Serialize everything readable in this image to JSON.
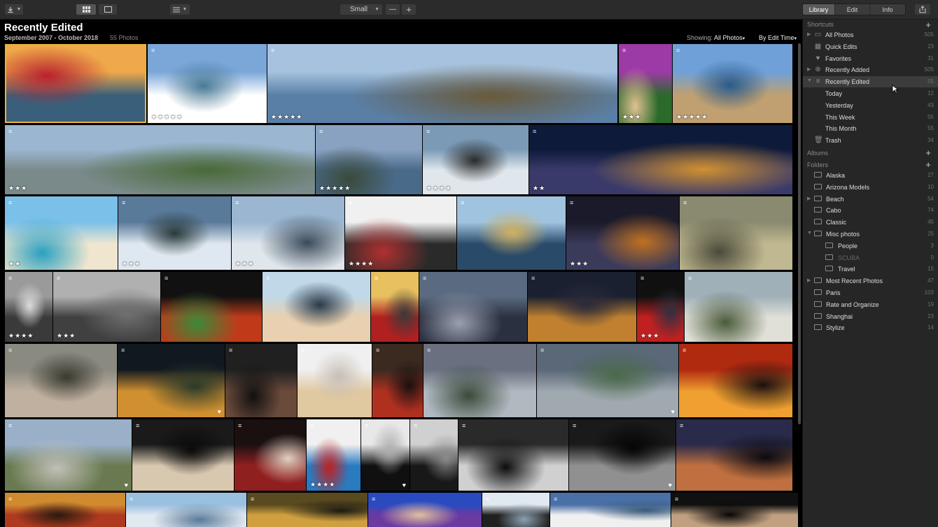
{
  "toolbar": {
    "import_icon": "download-icon",
    "view_grid_icon": "grid-icon",
    "view_single_icon": "single-view-icon",
    "sort_icon": "list-icon",
    "thumb_size": "Small",
    "zoom_out": "—",
    "zoom_in": "+",
    "modes": [
      "Library",
      "Edit",
      "Info"
    ],
    "active_mode": "Library",
    "share_icon": "share-icon"
  },
  "header": {
    "title": "Recently Edited",
    "date_range": "September 2007 - October 2018",
    "count": "55 Photos",
    "showing_label": "Showing:",
    "showing_value": "All Photos",
    "sort_value": "By Edit Time"
  },
  "sidebar": {
    "shortcuts_label": "Shortcuts",
    "shortcuts": [
      {
        "label": "All Photos",
        "count": "505",
        "icon": "photos-icon",
        "expandable": true
      },
      {
        "label": "Quick Edits",
        "count": "23",
        "icon": "quick-edits-icon"
      },
      {
        "label": "Favorites",
        "count": "31",
        "icon": "heart-icon"
      },
      {
        "label": "Recently Added",
        "count": "505",
        "icon": "plus-circle-icon",
        "expandable": true
      },
      {
        "label": "Recently Edited",
        "count": "55",
        "icon": "sliders-icon",
        "expandable": true,
        "selected": true
      },
      {
        "label": "Today",
        "count": "12",
        "indent": true
      },
      {
        "label": "Yesterday",
        "count": "43",
        "indent": true
      },
      {
        "label": "This Week",
        "count": "55",
        "indent": true
      },
      {
        "label": "This Month",
        "count": "55",
        "indent": true
      },
      {
        "label": "Trash",
        "count": "34",
        "icon": "trash-icon"
      }
    ],
    "albums_label": "Albums",
    "folders_label": "Folders",
    "folders": [
      {
        "label": "Alaska",
        "count": "27"
      },
      {
        "label": "Arizona Models",
        "count": "10"
      },
      {
        "label": "Beach",
        "count": "54",
        "expandable": true
      },
      {
        "label": "Cabo",
        "count": "74"
      },
      {
        "label": "Classic",
        "count": "45"
      },
      {
        "label": "Misc photos",
        "count": "25",
        "expandable": true,
        "open": true
      },
      {
        "label": "People",
        "count": "3",
        "sub": true
      },
      {
        "label": "SCUBA",
        "count": "0",
        "sub": true,
        "dim": true
      },
      {
        "label": "Travel",
        "count": "15",
        "sub": true
      },
      {
        "label": "Most Recent Photos",
        "count": "47",
        "expandable": true
      },
      {
        "label": "Paris",
        "count": "103"
      },
      {
        "label": "Rate and Organize",
        "count": "19"
      },
      {
        "label": "Shanghai",
        "count": "23"
      },
      {
        "label": "Stylize",
        "count": "14"
      }
    ]
  },
  "photos": [
    {
      "stars": 0,
      "c1": "#f0a94a",
      "c2": "#3a5f7a",
      "c3": "#b8222e",
      "selected": true
    },
    {
      "stars": 5,
      "c1": "#7aa6d8",
      "c2": "#ffffff",
      "c3": "#4a7a96"
    },
    {
      "stars": 5,
      "c1": "#a6c2de",
      "c2": "#5a7fa6",
      "c3": "#6a5a3a"
    },
    {
      "stars": 3,
      "c1": "#9c3aa6",
      "c2": "#2a6a2a",
      "c3": "#e0c090"
    },
    {
      "stars": 5,
      "c1": "#6fa0d8",
      "c2": "#c0a070",
      "c3": "#2a5a8a"
    },
    {
      "stars": 3,
      "c1": "#9ab6d0",
      "c2": "#7a8a8a",
      "c3": "#4a6a3a"
    },
    {
      "stars": 5,
      "c1": "#8aa2c2",
      "c2": "#4a6a8a",
      "c3": "#3a4a3a"
    },
    {
      "stars": 4,
      "c1": "#7a9ab6",
      "c2": "#dfe6ec",
      "c3": "#2a2a2a"
    },
    {
      "stars": 2,
      "c1": "#0e1a3a",
      "c2": "#3a3a6a",
      "c3": "#d09030"
    },
    {
      "stars": 2,
      "c1": "#7ac0e8",
      "c2": "#f0e6d0",
      "c3": "#2aa0c0"
    },
    {
      "stars": 3,
      "c1": "#5a7a9a",
      "c2": "#dfe8f0",
      "c3": "#2a3a3a"
    },
    {
      "stars": 3,
      "c1": "#9ab6d0",
      "c2": "#dfe6ec",
      "c3": "#3a4a5a"
    },
    {
      "stars": 4,
      "c1": "#f0f0f0",
      "c2": "#2a2a2a",
      "c3": "#b03030"
    },
    {
      "stars": 0,
      "c1": "#a0c4e0",
      "c2": "#2a4a6a",
      "c3": "#d0b060"
    },
    {
      "stars": 3,
      "c1": "#1a1a2a",
      "c2": "#3a3a5a",
      "c3": "#c07020"
    },
    {
      "stars": 0,
      "c1": "#8a8a70",
      "c2": "#c0b890",
      "c3": "#4a4a3a"
    },
    {
      "stars": 4,
      "c1": "#9a9a9a",
      "c2": "#3a3a3a",
      "c3": "#dcdcdc"
    },
    {
      "stars": 3,
      "c1": "#b0b0b0",
      "c2": "#404040",
      "c3": "#707070"
    },
    {
      "stars": 0,
      "c1": "#111111",
      "c2": "#c03a1a",
      "c3": "#3a8a3a"
    },
    {
      "stars": 0,
      "c1": "#c0d8e8",
      "c2": "#e8d0b0",
      "c3": "#2a3a4a"
    },
    {
      "stars": 0,
      "c1": "#e8c060",
      "c2": "#b02020",
      "c3": "#3a3a3a"
    },
    {
      "stars": 0,
      "c1": "#5a6a80",
      "c2": "#2a3040",
      "c3": "#9aa0b0"
    },
    {
      "stars": 0,
      "c1": "#1a2030",
      "c2": "#c08030",
      "c3": "#2a2a3a"
    },
    {
      "stars": 3,
      "c1": "#101010",
      "c2": "#c02020",
      "c3": "#303040"
    },
    {
      "stars": 0,
      "c1": "#a0b0b8",
      "c2": "#e0e0d8",
      "c3": "#4a5a3a"
    },
    {
      "stars": 0,
      "c1": "#8a8a80",
      "c2": "#c0b0a0",
      "c3": "#3a3a30"
    },
    {
      "stars": 0,
      "c1": "#101820",
      "c2": "#d09030",
      "c3": "#2a3a2a",
      "heart": true
    },
    {
      "stars": 0,
      "c1": "#202020",
      "c2": "#6a4a3a",
      "c3": "#101010"
    },
    {
      "stars": 0,
      "c1": "#f0f0f0",
      "c2": "#e0c8a0",
      "c3": "#c8c0b8"
    },
    {
      "stars": 0,
      "c1": "#3a2a20",
      "c2": "#b03020",
      "c3": "#1a1010"
    },
    {
      "stars": 0,
      "c1": "#6a7080",
      "c2": "#b0b8c0",
      "c3": "#3a4a3a"
    },
    {
      "stars": 0,
      "c1": "#5a6878",
      "c2": "#a0a8b0",
      "c3": "#4a6a4a",
      "heart": true
    },
    {
      "stars": 0,
      "c1": "#b02a10",
      "c2": "#f0a030",
      "c3": "#1a1010"
    },
    {
      "stars": 0,
      "c1": "#9ab0c8",
      "c2": "#6a7a50",
      "c3": "#c0c0b8",
      "heart": true
    },
    {
      "stars": 0,
      "c1": "#1a1a1a",
      "c2": "#d8c8b0",
      "c3": "#0a0a0a"
    },
    {
      "stars": 0,
      "c1": "#1a1010",
      "c2": "#902020",
      "c3": "#e0d0c0"
    },
    {
      "stars": 4,
      "c1": "#f0f0f0",
      "c2": "#2a7ac0",
      "c3": "#c02020"
    },
    {
      "stars": 0,
      "c1": "#e8e8e8",
      "c2": "#101010",
      "c3": "#b0b0b0",
      "heart": true
    },
    {
      "stars": 0,
      "c1": "#d0d0d0",
      "c2": "#181818",
      "c3": "#8a8a8a"
    },
    {
      "stars": 0,
      "c1": "#2a2a2a",
      "c2": "#d0d0d0",
      "c3": "#0a0a0a"
    },
    {
      "stars": 0,
      "c1": "#1a1a1a",
      "c2": "#909090",
      "c3": "#050505",
      "heart": true
    },
    {
      "stars": 0,
      "c1": "#2a2a4a",
      "c2": "#c07040",
      "c3": "#0a0a10"
    },
    {
      "stars": 0,
      "c1": "#d08a30",
      "c2": "#b03a20",
      "c3": "#2a1a10"
    },
    {
      "stars": 0,
      "c1": "#9ac0e0",
      "c2": "#e0e8f0",
      "c3": "#5a7a9a"
    },
    {
      "stars": 0,
      "c1": "#5a4a20",
      "c2": "#d0a040",
      "c3": "#1a1a10"
    },
    {
      "stars": 0,
      "c1": "#2a4ac0",
      "c2": "#6a3aa0",
      "c3": "#e0c0a0"
    },
    {
      "stars": 0,
      "c1": "#e0e8f0",
      "c2": "#202020",
      "c3": "#8aa0b0"
    },
    {
      "stars": 0,
      "c1": "#4a70a8",
      "c2": "#f0f0f0",
      "c3": "#3a5a7a"
    },
    {
      "stars": 0,
      "c1": "#101010",
      "c2": "#c0a080",
      "c3": "#050505"
    }
  ]
}
